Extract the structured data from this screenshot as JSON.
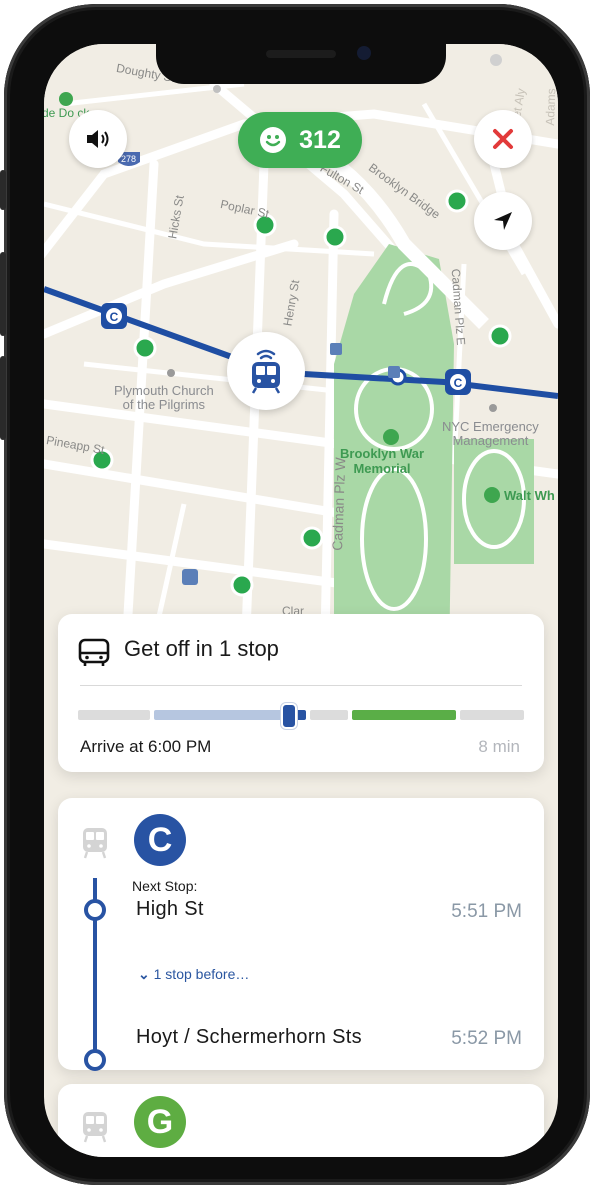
{
  "map": {
    "labels": {
      "doughty": "Doughty St",
      "de_dock": "de Do  ck",
      "interstate": "278",
      "poplar": "Poplar St",
      "fulton": "Fulton St",
      "brooklyn_bridge": "Brooklyn Bridge",
      "hicks": "Hicks St",
      "henry": "Henry St",
      "cadman_e": "Cadman Plz E",
      "cadman_w": "Cadman Plz W",
      "plymouth": "Plymouth Church\nof the Pilgrims",
      "nyc_em": "NYC Emergency\nManagement",
      "brooklyn_war": "Brooklyn War\nMemorial",
      "walt": "Walt Wh",
      "pineapple": "Pineapp  St",
      "et_aly": "et Aly",
      "adams": "Adams",
      "clar": "Clar",
      "line_badge_c": "C"
    },
    "colors": {
      "subway_line": "#1f4ea3",
      "park": "#a8d8a8",
      "station_dot": "#2aa84e"
    }
  },
  "controls": {
    "sound_icon": "speaker-icon",
    "score": "312",
    "close_icon": "close-icon",
    "locate_icon": "navigation-arrow-icon"
  },
  "trip_card": {
    "title": "Get off in 1 stop",
    "arrive": "Arrive at 6:00 PM",
    "eta": "8 min",
    "progress": 0.47
  },
  "route_card": {
    "line": "C",
    "line_color": "#2853a3",
    "next_stop_label": "Next Stop:",
    "stops": [
      {
        "name": "High St",
        "time": "5:51 PM"
      },
      {
        "name": "Hoyt / Schermerhorn Sts",
        "time": "5:52 PM"
      }
    ],
    "stops_before": "1 stop before…"
  },
  "next_route": {
    "line": "G",
    "line_color": "#5ead42"
  }
}
